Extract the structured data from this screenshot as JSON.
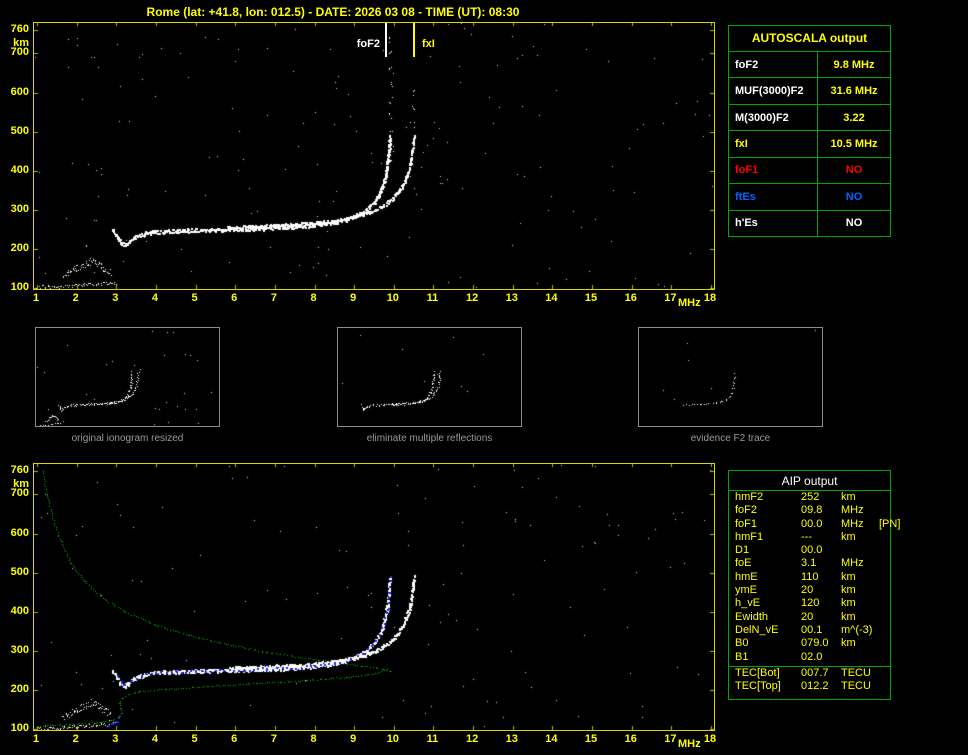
{
  "header": {
    "title": "Rome (lat: +41.8, lon: 012.5) - DATE: 2026 03 08 - TIME (UT): 08:30"
  },
  "colors": {
    "background": "#000000",
    "axis_yellow": "#ffff00",
    "plot_border": "#d8d800",
    "tick_yellow": "#bbbb00",
    "trace_white": "#ffffff",
    "profile_green": "#00bb00",
    "fit_blue": "#2323ff",
    "table_green": "#00aa00",
    "caption_gray": "#9a9a9a",
    "no_red": "#ff0000",
    "no_blue": "#0066ff"
  },
  "top_plot": {
    "y_unit": "km",
    "x_unit": "MHz",
    "y_ticks": [
      760,
      700,
      600,
      500,
      400,
      300,
      200,
      100
    ],
    "x_ticks": [
      1,
      2,
      3,
      4,
      5,
      6,
      7,
      8,
      9,
      10,
      11,
      12,
      13,
      14,
      15,
      16,
      17,
      18
    ],
    "markers": [
      {
        "label": "foF2",
        "freq": 9.8,
        "color": "#ffffff",
        "side": "left"
      },
      {
        "label": "fxI",
        "freq": 10.5,
        "color": "#ffff00",
        "side": "right"
      }
    ]
  },
  "bottom_plot": {
    "y_unit": "km",
    "x_unit": "MHz",
    "y_ticks": [
      760,
      700,
      600,
      500,
      400,
      300,
      200,
      100
    ],
    "x_ticks": [
      1,
      2,
      3,
      4,
      5,
      6,
      7,
      8,
      9,
      10,
      11,
      12,
      13,
      14,
      15,
      16,
      17,
      18
    ],
    "markers": []
  },
  "autoscala_table": {
    "title": "AUTOSCALA output",
    "rows": [
      {
        "label": "foF2",
        "value": "9.8 MHz",
        "label_color": "#ffffff",
        "value_color": "#ffff00"
      },
      {
        "label": "MUF(3000)F2",
        "value": "31.6 MHz",
        "label_color": "#ffffff",
        "value_color": "#ffff00"
      },
      {
        "label": "M(3000)F2",
        "value": "3.22",
        "label_color": "#ffffff",
        "value_color": "#ffff00"
      },
      {
        "label": "fxI",
        "value": "10.5 MHz",
        "label_color": "#ffff00",
        "value_color": "#ffff00"
      },
      {
        "label": "foF1",
        "value": "NO",
        "label_color": "#ff0000",
        "value_color": "#ff0000"
      },
      {
        "label": "ftEs",
        "value": "NO",
        "label_color": "#0066ff",
        "value_color": "#0066ff"
      },
      {
        "label": "h'Es",
        "value": "NO",
        "label_color": "#ffffff",
        "value_color": "#ffffff"
      }
    ]
  },
  "thumbnails": [
    {
      "caption": "original ionogram resized"
    },
    {
      "caption": "eliminate multiple reflections"
    },
    {
      "caption": "evidence F2 trace"
    }
  ],
  "aip_table": {
    "title": "AIP output",
    "rows": [
      {
        "name": "hmF2",
        "value": "252",
        "unit": "km",
        "extra": ""
      },
      {
        "name": "foF2",
        "value": "09.8",
        "unit": "MHz",
        "extra": ""
      },
      {
        "name": "foF1",
        "value": "00.0",
        "unit": "MHz",
        "extra": "[PN]"
      },
      {
        "name": "hmF1",
        "value": "---",
        "unit": "km",
        "extra": ""
      },
      {
        "name": "D1",
        "value": "00.0",
        "unit": "",
        "extra": ""
      },
      {
        "name": "foE",
        "value": "3.1",
        "unit": "MHz",
        "extra": ""
      },
      {
        "name": "hmE",
        "value": "110",
        "unit": "km",
        "extra": ""
      },
      {
        "name": "ymE",
        "value": "20",
        "unit": "km",
        "extra": ""
      },
      {
        "name": "h_vE",
        "value": "120",
        "unit": "km",
        "extra": ""
      },
      {
        "name": "Ewidth",
        "value": "20",
        "unit": "km",
        "extra": ""
      },
      {
        "name": "DelN_vE",
        "value": "00.1",
        "unit": "m^(-3)",
        "extra": ""
      },
      {
        "name": "B0",
        "value": "079.0",
        "unit": "km",
        "extra": ""
      },
      {
        "name": "B1",
        "value": "02.0",
        "unit": "",
        "extra": ""
      }
    ],
    "tec_rows": [
      {
        "name": "TEC[Bot]",
        "value": "007.7",
        "unit": "TECU"
      },
      {
        "name": "TEC[Top]",
        "value": "012.2",
        "unit": "TECU"
      }
    ]
  },
  "chart_data": {
    "type": "scatter",
    "xlabel": "MHz",
    "ylabel": "km",
    "xlim": [
      1,
      18
    ],
    "ylim": [
      90,
      770
    ],
    "plots": [
      {
        "name": "scaled-ionogram",
        "series_used": [
          "es_layer",
          "es_cluster",
          "o_trace",
          "x_trace",
          "foF2_spread"
        ],
        "annotations": [
          {
            "label": "foF2",
            "x_mhz": 9.8
          },
          {
            "label": "fxI",
            "x_mhz": 10.5
          }
        ]
      },
      {
        "name": "ionogram-with-electron-density-profile",
        "series_used": [
          "es_layer",
          "es_cluster",
          "o_trace",
          "x_trace",
          "profile",
          "fit_E",
          "fit_F"
        ]
      }
    ],
    "series": {
      "es_layer": [
        [
          1.0,
          102
        ],
        [
          1.3,
          103
        ],
        [
          1.6,
          105
        ],
        [
          1.9,
          107
        ],
        [
          2.2,
          109
        ],
        [
          2.5,
          111
        ],
        [
          2.8,
          113
        ],
        [
          3.0,
          114
        ]
      ],
      "es_cluster": [
        [
          1.65,
          130
        ],
        [
          1.8,
          138
        ],
        [
          1.95,
          147
        ],
        [
          2.1,
          155
        ],
        [
          2.25,
          163
        ],
        [
          2.4,
          170
        ],
        [
          2.55,
          160
        ],
        [
          2.7,
          148
        ],
        [
          2.85,
          138
        ]
      ],
      "o_trace": [
        [
          2.9,
          250
        ],
        [
          3.0,
          234
        ],
        [
          3.1,
          219
        ],
        [
          3.2,
          211
        ],
        [
          3.3,
          219
        ],
        [
          3.45,
          231
        ],
        [
          3.7,
          240
        ],
        [
          4.0,
          245
        ],
        [
          4.5,
          247
        ],
        [
          5.0,
          249
        ],
        [
          5.5,
          250
        ],
        [
          6.0,
          251
        ],
        [
          6.5,
          253
        ],
        [
          7.0,
          255
        ],
        [
          7.5,
          258
        ],
        [
          8.0,
          262
        ],
        [
          8.4,
          268
        ],
        [
          8.8,
          277
        ],
        [
          9.1,
          289
        ],
        [
          9.3,
          302
        ],
        [
          9.5,
          321
        ],
        [
          9.65,
          346
        ],
        [
          9.75,
          376
        ],
        [
          9.82,
          410
        ],
        [
          9.86,
          448
        ],
        [
          9.89,
          488
        ]
      ],
      "x_trace": [
        [
          5.8,
          256
        ],
        [
          6.5,
          259
        ],
        [
          7.2,
          262
        ],
        [
          7.9,
          267
        ],
        [
          8.5,
          274
        ],
        [
          9.0,
          283
        ],
        [
          9.4,
          295
        ],
        [
          9.7,
          310
        ],
        [
          9.95,
          329
        ],
        [
          10.15,
          354
        ],
        [
          10.3,
          384
        ],
        [
          10.4,
          418
        ],
        [
          10.46,
          455
        ],
        [
          10.5,
          492
        ]
      ],
      "foF2_spread": [
        [
          9.9,
          420
        ],
        [
          9.92,
          460
        ],
        [
          9.94,
          500
        ],
        [
          9.9,
          540
        ],
        [
          9.93,
          580
        ],
        [
          9.91,
          620
        ],
        [
          9.94,
          660
        ],
        [
          9.92,
          700
        ],
        [
          9.9,
          740
        ],
        [
          10.45,
          520
        ],
        [
          10.5,
          560
        ],
        [
          10.47,
          600
        ]
      ],
      "profile": [
        [
          1.15,
          760
        ],
        [
          1.25,
          700
        ],
        [
          1.4,
          640
        ],
        [
          1.6,
          580
        ],
        [
          1.85,
          525
        ],
        [
          2.2,
          478
        ],
        [
          2.7,
          432
        ],
        [
          3.3,
          396
        ],
        [
          4.0,
          366
        ],
        [
          4.8,
          341
        ],
        [
          5.7,
          319
        ],
        [
          6.7,
          299
        ],
        [
          7.7,
          283
        ],
        [
          8.7,
          269
        ],
        [
          9.4,
          259
        ],
        [
          9.75,
          254
        ],
        [
          9.82,
          252
        ],
        [
          9.5,
          242
        ],
        [
          8.8,
          233
        ],
        [
          7.8,
          225
        ],
        [
          6.5,
          217
        ],
        [
          5.2,
          209
        ],
        [
          4.2,
          202
        ],
        [
          3.6,
          196
        ],
        [
          3.3,
          189
        ],
        [
          3.15,
          179
        ],
        [
          3.08,
          167
        ],
        [
          3.1,
          154
        ],
        [
          3.14,
          142
        ],
        [
          3.08,
          131
        ],
        [
          2.9,
          123
        ],
        [
          2.6,
          118
        ],
        [
          2.2,
          115
        ],
        [
          1.8,
          112
        ],
        [
          1.4,
          110
        ],
        [
          1.0,
          108
        ]
      ],
      "fit_E": [
        [
          2.8,
          108
        ],
        [
          2.9,
          114
        ],
        [
          3.0,
          122
        ],
        [
          3.05,
          132
        ]
      ],
      "fit_F": [
        [
          3.0,
          236
        ],
        [
          3.1,
          221
        ],
        [
          3.2,
          213
        ],
        [
          3.35,
          223
        ],
        [
          3.6,
          237
        ],
        [
          4.0,
          245
        ],
        [
          4.5,
          247
        ],
        [
          5.0,
          249
        ],
        [
          5.6,
          251
        ],
        [
          6.2,
          253
        ],
        [
          6.8,
          255
        ],
        [
          7.4,
          258
        ],
        [
          8.0,
          263
        ],
        [
          8.5,
          271
        ],
        [
          8.9,
          281
        ],
        [
          9.2,
          295
        ],
        [
          9.45,
          315
        ],
        [
          9.62,
          342
        ],
        [
          9.74,
          372
        ],
        [
          9.82,
          408
        ],
        [
          9.87,
          450
        ],
        [
          9.9,
          495
        ]
      ],
      "f2_only": [
        [
          5.0,
          249
        ],
        [
          5.8,
          251
        ],
        [
          6.6,
          253
        ],
        [
          7.4,
          258
        ],
        [
          8.1,
          264
        ],
        [
          8.7,
          275
        ],
        [
          9.1,
          289
        ],
        [
          9.4,
          308
        ],
        [
          9.6,
          335
        ],
        [
          9.75,
          370
        ],
        [
          9.83,
          412
        ],
        [
          9.87,
          450
        ],
        [
          9.9,
          485
        ]
      ]
    }
  }
}
